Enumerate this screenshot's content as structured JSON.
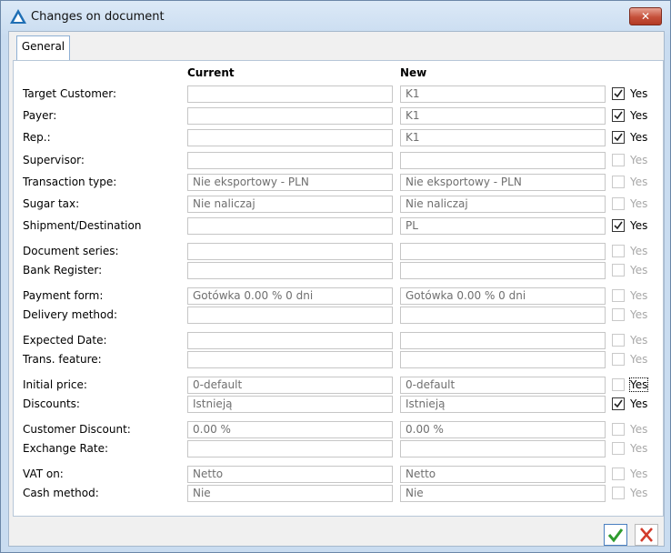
{
  "window": {
    "title": "Changes on document"
  },
  "tabs": [
    {
      "label": "General"
    }
  ],
  "columns": {
    "current": "Current",
    "new": "New"
  },
  "labels": {
    "target_customer": "Target Customer:",
    "payer": "Payer:",
    "rep": "Rep.:",
    "supervisor": "Supervisor:",
    "transaction_type": "Transaction type:",
    "sugar_tax": "Sugar tax:",
    "shipment": "Shipment/Destination",
    "document_series": "Document series:",
    "bank_register": "Bank Register:",
    "payment_form": "Payment form:",
    "delivery_method": "Delivery method:",
    "expected_date": "Expected Date:",
    "trans_feature": "Trans. feature:",
    "initial_price": "Initial price:",
    "discounts": "Discounts:",
    "customer_discount": "Customer Discount:",
    "exchange_rate": "Exchange Rate:",
    "vat_on": "VAT on:",
    "cash_method": "Cash method:"
  },
  "current": {
    "target_customer": "",
    "payer": "",
    "rep": "",
    "supervisor": "",
    "transaction_type": "Nie eksportowy - PLN",
    "sugar_tax": "Nie naliczaj",
    "shipment": "",
    "document_series": "",
    "bank_register": "",
    "payment_form": "Gotówka   0.00 % 0 dni",
    "delivery_method": "",
    "expected_date": "",
    "trans_feature": "",
    "initial_price": " 0-default",
    "discounts": "Istnieją",
    "customer_discount": " 0.00 %",
    "exchange_rate": "",
    "vat_on": "Netto",
    "cash_method": "Nie"
  },
  "new": {
    "target_customer": "K1",
    "payer": "K1",
    "rep": "K1",
    "supervisor": "",
    "transaction_type": "Nie eksportowy - PLN",
    "sugar_tax": "Nie naliczaj",
    "shipment": "PL",
    "document_series": "",
    "bank_register": "",
    "payment_form": "Gotówka   0.00 % 0 dni",
    "delivery_method": "",
    "expected_date": "",
    "trans_feature": "",
    "initial_price": " 0-default",
    "discounts": "Istnieją",
    "customer_discount": " 0.00 %",
    "exchange_rate": "",
    "vat_on": "Netto",
    "cash_method": "Nie"
  },
  "yes_label": "Yes",
  "apply": {
    "target_customer": true,
    "payer": true,
    "rep": true,
    "supervisor": false,
    "transaction_type": false,
    "sugar_tax": false,
    "shipment": true,
    "document_series": false,
    "bank_register": false,
    "payment_form": false,
    "delivery_method": false,
    "expected_date": false,
    "trans_feature": false,
    "initial_price": false,
    "discounts": true,
    "customer_discount": false,
    "exchange_rate": false,
    "vat_on": false,
    "cash_method": false
  },
  "icons": {
    "app": "app-triangle-icon",
    "close": "close-icon",
    "ok": "checkmark-icon",
    "cancel": "x-icon"
  },
  "colors": {
    "ok_green": "#2e9b2e",
    "cancel_red": "#d23a2a",
    "close_red": "#c5503a"
  }
}
